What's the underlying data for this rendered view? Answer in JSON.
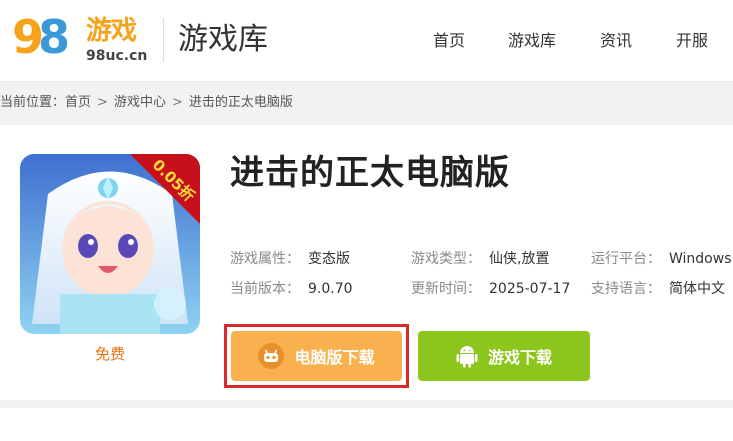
{
  "header": {
    "logo_number": "98",
    "logo_cn": "游戏",
    "logo_domain": "98uc.cn",
    "section_title": "游戏库",
    "nav": [
      "首页",
      "游戏库",
      "资讯",
      "开服"
    ]
  },
  "breadcrumb": {
    "label": "当前位置：",
    "items": [
      "首页",
      "游戏中心",
      "进击的正太电脑版"
    ],
    "separator": ">"
  },
  "game": {
    "title": "进击的正太电脑版",
    "icon_badge": "0.05折",
    "price_tag": "免费",
    "attributes": {
      "row1": [
        {
          "key": "游戏属性：",
          "value": "变态版"
        },
        {
          "key": "游戏类型：",
          "value": "仙侠,放置"
        },
        {
          "key": "运行平台：",
          "value": "Windows"
        }
      ],
      "row2": [
        {
          "key": "当前版本：",
          "value": "9.0.70"
        },
        {
          "key": "更新时间：",
          "value": "2025-07-17"
        },
        {
          "key": "支持语言：",
          "value": "简体中文"
        }
      ]
    },
    "buttons": {
      "pc_download": "电脑版下载",
      "game_download": "游戏下载"
    }
  },
  "colors": {
    "accent_orange": "#f9b04e",
    "accent_green": "#8cc61c",
    "highlight_red": "#d9292b"
  }
}
